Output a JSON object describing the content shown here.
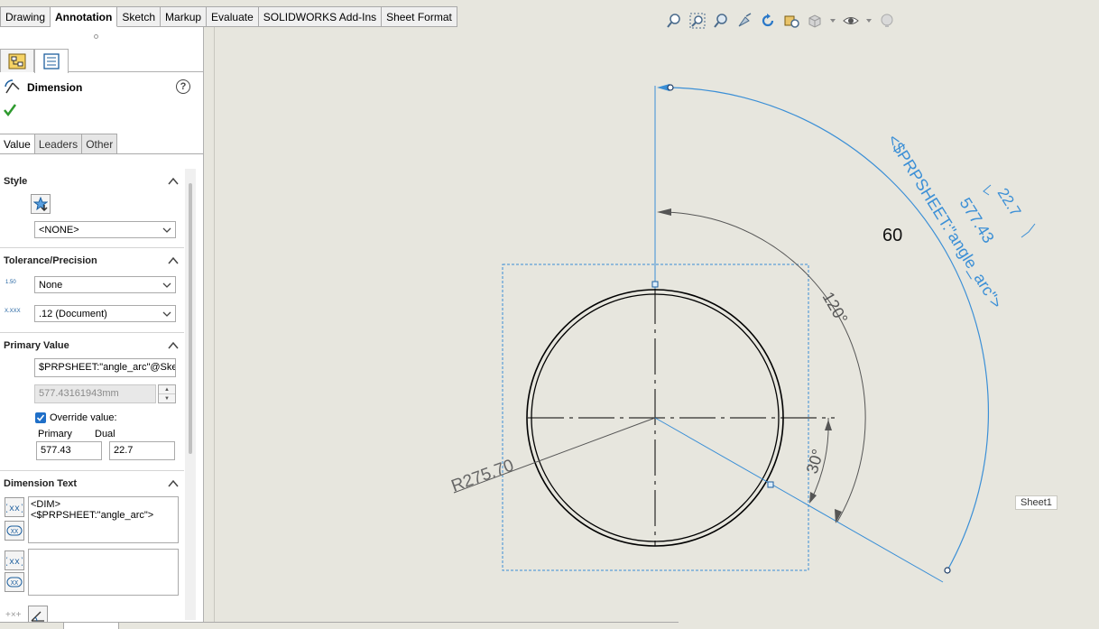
{
  "ribbon": {
    "tabs": [
      {
        "label": "Drawing",
        "active": false
      },
      {
        "label": "Annotation",
        "active": true
      },
      {
        "label": "Sketch",
        "active": false
      },
      {
        "label": "Markup",
        "active": false
      },
      {
        "label": "Evaluate",
        "active": false
      },
      {
        "label": "SOLIDWORKS Add-Ins",
        "active": false
      },
      {
        "label": "Sheet Format",
        "active": false
      }
    ]
  },
  "hud": {
    "icons": [
      "zoom-to-fit-icon",
      "zoom-to-area-icon",
      "zoom-previous-icon",
      "select-tool-icon",
      "rotate-icon",
      "pan-icon",
      "view-orientation-icon",
      "hide-show-icon",
      "appearance-icon"
    ]
  },
  "panel": {
    "title": "Dimension",
    "help": "?",
    "tabs": {
      "value": "Value",
      "leaders": "Leaders",
      "other": "Other"
    },
    "style": {
      "heading": "Style",
      "selected": "<NONE>"
    },
    "tolerance": {
      "heading": "Tolerance/Precision",
      "tolerance_type": "None",
      "precision": ".12 (Document)",
      "tol_icon_text": "1.50",
      "prec_icon_text": "X.XXX"
    },
    "primary_value": {
      "heading": "Primary Value",
      "reference": "$PRPSHEET:\"angle_arc\"@Sket",
      "value": "577.43161943mm",
      "override_label": "Override value:",
      "override_checked": true,
      "primary_label": "Primary",
      "dual_label": "Dual",
      "primary": "577.43",
      "dual": "22.7"
    },
    "dimension_text": {
      "heading": "Dimension Text",
      "line1": "<DIM>",
      "line2": "<$PRPSHEET:\"angle_arc\">",
      "lower": ""
    }
  },
  "canvas": {
    "sheet_label": "Sheet1",
    "dimensions": {
      "radius": "R275.70",
      "angle_120": "120°",
      "angle_30": "30°",
      "value_60": "60",
      "arc_text": "<$PRPSHEET:\"angle_arc\">",
      "arc_primary": "577.43",
      "arc_dual": "22.7"
    }
  }
}
